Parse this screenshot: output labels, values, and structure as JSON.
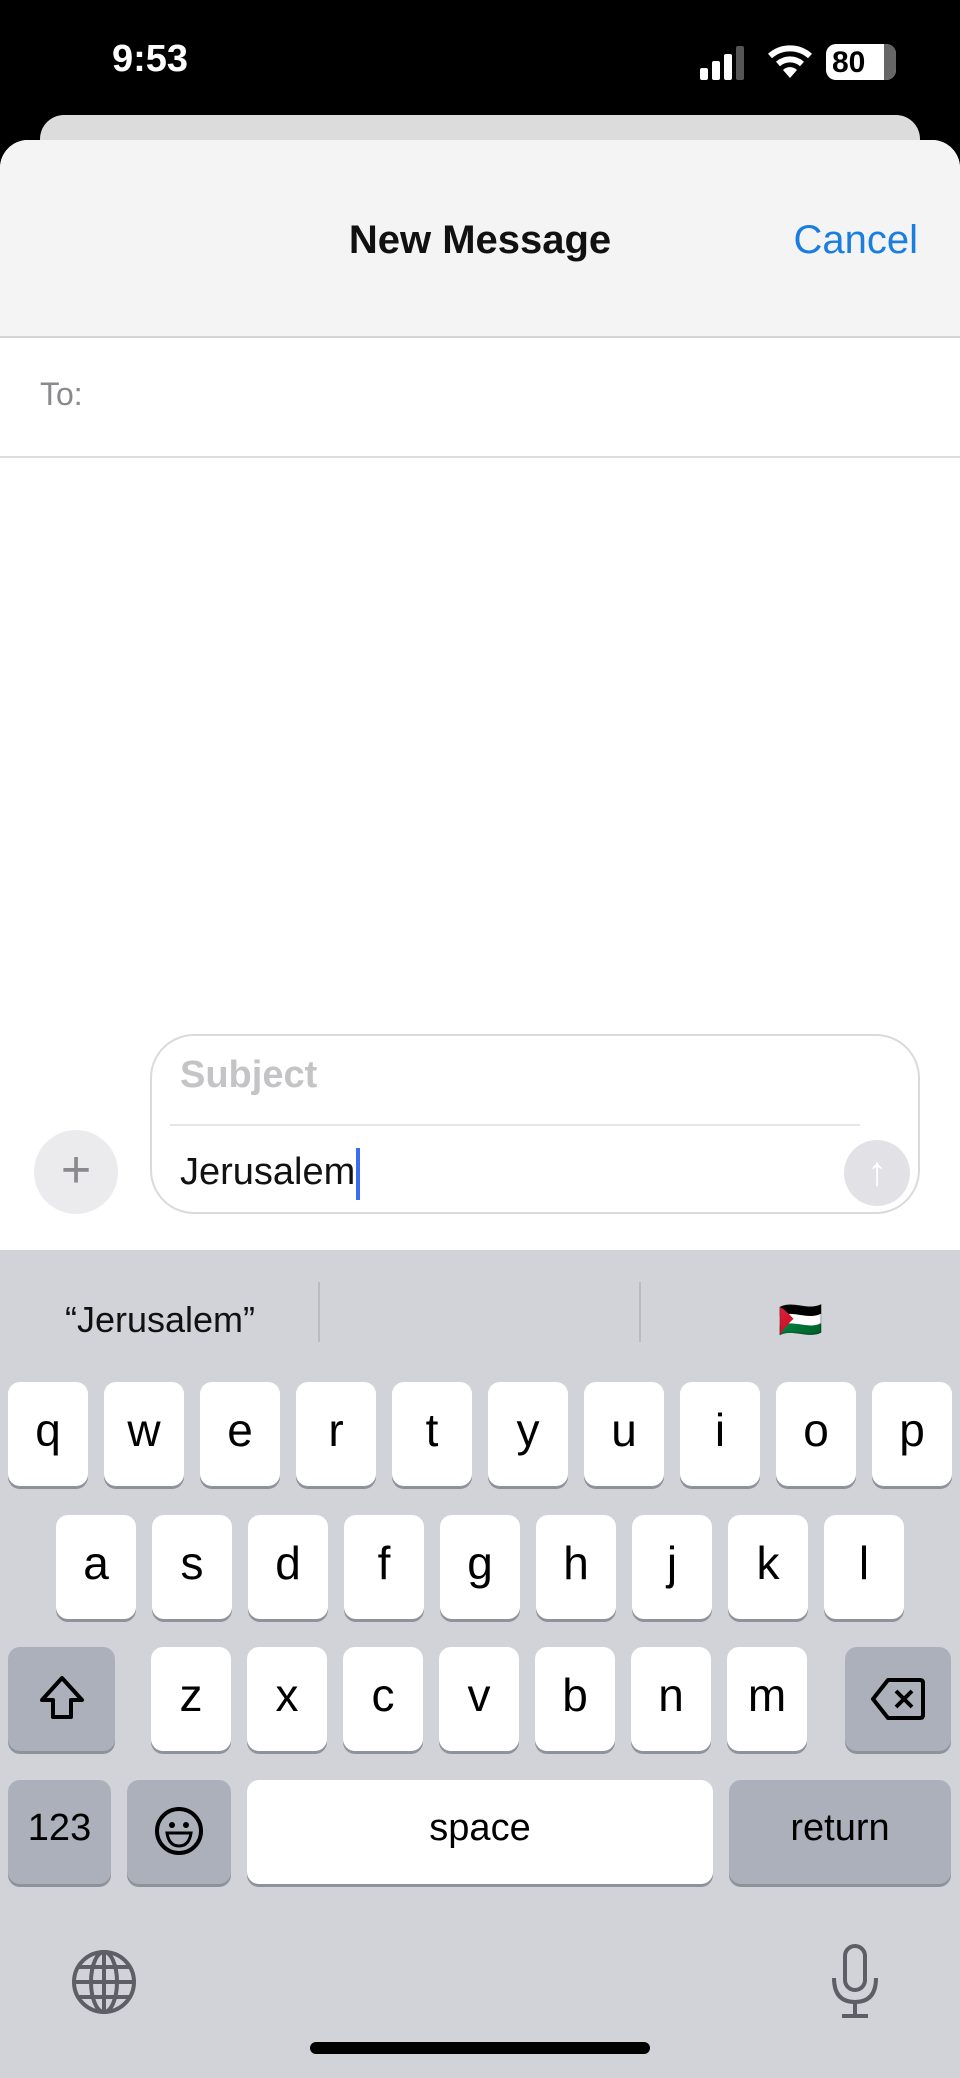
{
  "status_bar": {
    "time": "9:53",
    "battery": "80",
    "icons": [
      "cellular-signal-icon",
      "wifi-icon",
      "battery-icon"
    ]
  },
  "header": {
    "title": "New Message",
    "cancel_label": "Cancel",
    "accent": "#1a7ee0"
  },
  "to_field": {
    "label": "To:",
    "value": ""
  },
  "compose": {
    "subject_placeholder": "Subject",
    "body_value": "Jerusalem",
    "icons": [
      "plus-icon",
      "send-arrow-icon"
    ]
  },
  "keyboard": {
    "suggestions": [
      "“Jerusalem”",
      "",
      "🇵🇸"
    ],
    "rows": [
      [
        "q",
        "w",
        "e",
        "r",
        "t",
        "y",
        "u",
        "i",
        "o",
        "p"
      ],
      [
        "a",
        "s",
        "d",
        "f",
        "g",
        "h",
        "j",
        "k",
        "l"
      ],
      [
        "z",
        "x",
        "c",
        "v",
        "b",
        "n",
        "m"
      ]
    ],
    "numbers_label": "123",
    "space_label": "space",
    "return_label": "return",
    "icons": [
      "shift-icon",
      "delete-icon",
      "emoji-icon",
      "globe-icon",
      "microphone-icon"
    ]
  }
}
